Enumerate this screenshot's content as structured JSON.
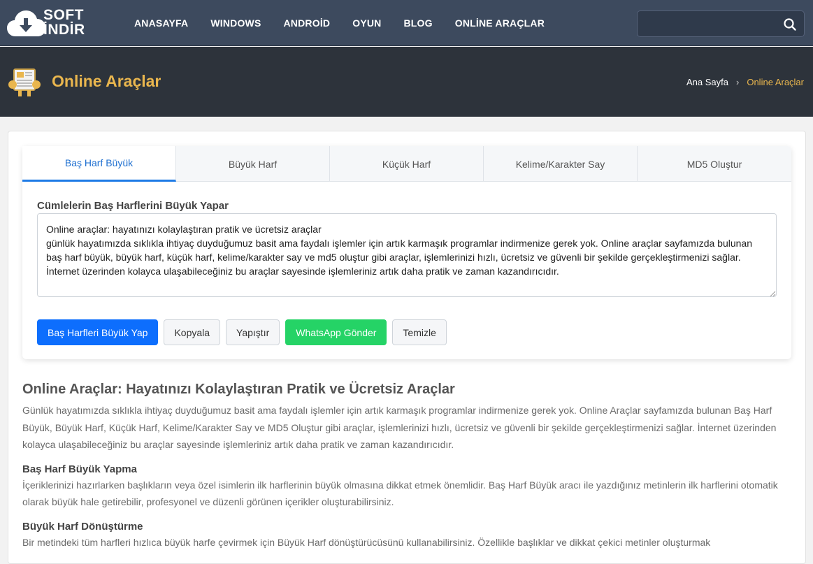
{
  "logo": {
    "line1": "SOFT",
    "line2": "İNDİR"
  },
  "nav": [
    "ANASAYFA",
    "WINDOWS",
    "ANDROİD",
    "OYUN",
    "BLOG",
    "ONLİNE ARAÇLAR"
  ],
  "search": {
    "value": "",
    "placeholder": ""
  },
  "page": {
    "title": "Online Araçlar"
  },
  "breadcrumb": {
    "home": "Ana Sayfa",
    "separator": "›",
    "current": "Online Araçlar"
  },
  "tabs": [
    "Baş Harf Büyük",
    "Büyük Harf",
    "Küçük Harf",
    "Kelime/Karakter Say",
    "MD5 Oluştur"
  ],
  "tool": {
    "label": "Cümlelerin Baş Harflerini Büyük Yapar",
    "text": "Online araçlar: hayatınızı kolaylaştıran pratik ve ücretsiz araçlar\ngünlük hayatımızda sıklıkla ihtiyaç duyduğumuz basit ama faydalı işlemler için artık karmaşık programlar indirmenize gerek yok. Online araçlar sayfamızda bulunan baş harf büyük, büyük harf, küçük harf, kelime/karakter say ve md5 oluştur gibi araçlar, işlemlerinizi hızlı, ücretsiz ve güvenli bir şekilde gerçekleştirmenizi sağlar. İnternet üzerinden kolayca ulaşabileceğiniz bu araçlar sayesinde işlemleriniz artık daha pratik ve zaman kazandırıcıdır.",
    "buttons": {
      "convert": "Baş Harfleri Büyük Yap",
      "copy": "Kopyala",
      "paste": "Yapıştır",
      "whatsapp": "WhatsApp Gönder",
      "clear": "Temizle"
    }
  },
  "article": {
    "heading": "Online Araçlar: Hayatınızı Kolaylaştıran Pratik ve Ücretsiz Araçlar",
    "intro": "Günlük hayatımızda sıklıkla ihtiyaç duyduğumuz basit ama faydalı işlemler için artık karmaşık programlar indirmenize gerek yok. Online Araçlar sayfamızda bulunan Baş Harf Büyük, Büyük Harf, Küçük Harf, Kelime/Karakter Say ve MD5 Oluştur gibi araçlar, işlemlerinizi hızlı, ücretsiz ve güvenli bir şekilde gerçekleştirmenizi sağlar. İnternet üzerinden kolayca ulaşabileceğiniz bu araçlar sayesinde işlemleriniz artık daha pratik ve zaman kazandırıcıdır.",
    "s1_title": "Baş Harf Büyük Yapma",
    "s1_text": "İçeriklerinizi hazırlarken başlıkların veya özel isimlerin ilk harflerinin büyük olmasına dikkat etmek önemlidir. Baş Harf Büyük aracı ile yazdığınız metinlerin ilk harflerini otomatik olarak büyük hale getirebilir, profesyonel ve düzenli görünen içerikler oluşturabilirsiniz.",
    "s2_title": "Büyük Harf Dönüştürme",
    "s2_text": "Bir metindeki tüm harfleri hızlıca büyük harfe çevirmek için Büyük Harf dönüştürücüsünü kullanabilirsiniz. Özellikle başlıklar ve dikkat çekici metinler oluşturmak"
  },
  "colors": {
    "accent": "#e9b64e",
    "nav_bg": "#3d4a5e",
    "primary": "#0d6efd",
    "whatsapp": "#25d366"
  }
}
